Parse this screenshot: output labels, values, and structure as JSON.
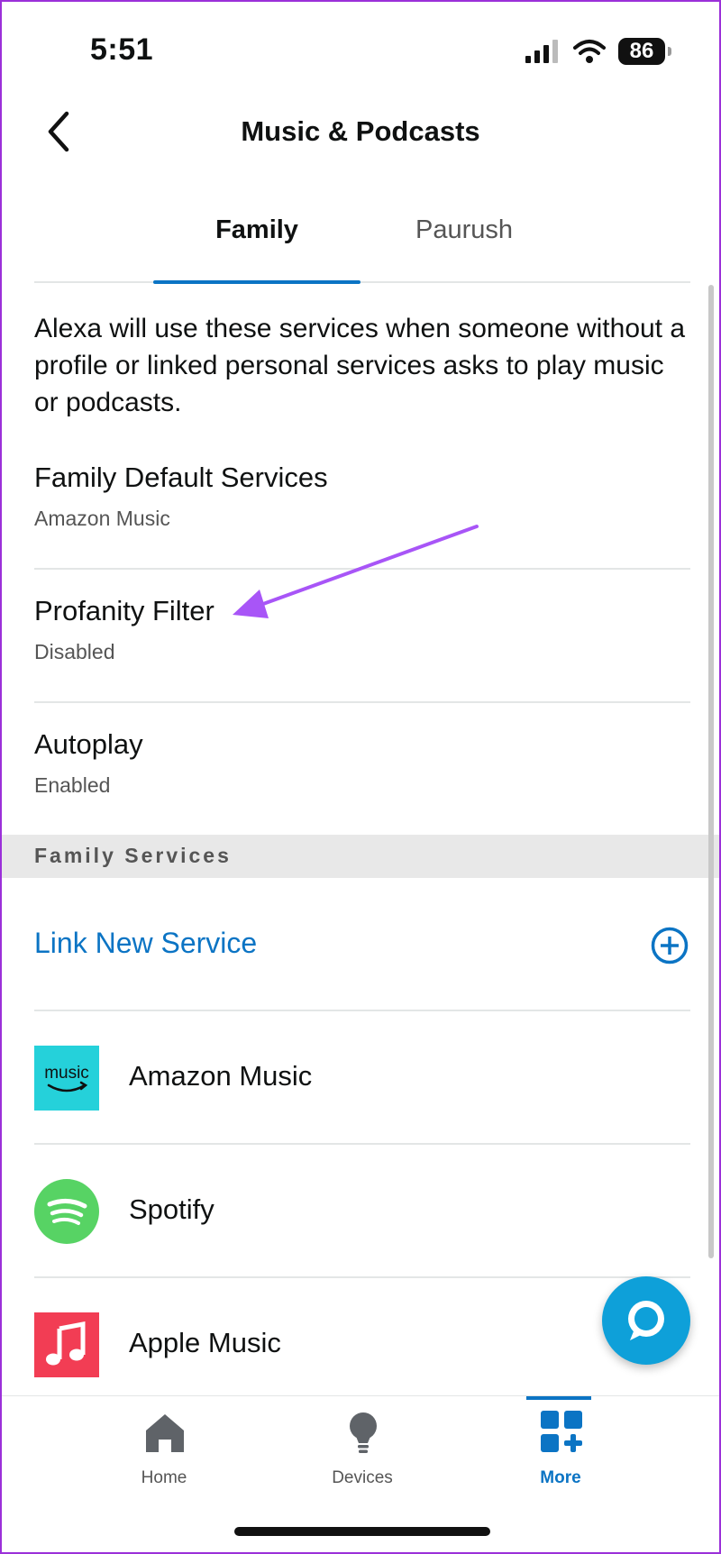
{
  "status_bar": {
    "time": "5:51",
    "battery": "86"
  },
  "header": {
    "title": "Music & Podcasts"
  },
  "tabs": [
    {
      "label": "Family",
      "active": true
    },
    {
      "label": "Paurush",
      "active": false
    }
  ],
  "description": "Alexa will use these services when someone without a profile or linked personal services asks to play music or podcasts.",
  "settings": [
    {
      "title": "Family Default Services",
      "value": "Amazon Music"
    },
    {
      "title": "Profanity Filter",
      "value": "Disabled"
    },
    {
      "title": "Autoplay",
      "value": "Enabled"
    }
  ],
  "family_services": {
    "section_label": "Family Services",
    "link_label": "Link New Service",
    "services": [
      {
        "name": "Amazon Music",
        "logo_text": "music",
        "logo_color": "#25d1da"
      },
      {
        "name": "Spotify",
        "logo_color": "#57d364"
      },
      {
        "name": "Apple Music",
        "logo_color": "#f23d54"
      }
    ]
  },
  "bottom_nav": [
    {
      "label": "Home",
      "icon": "home-icon",
      "active": false
    },
    {
      "label": "Devices",
      "icon": "lightbulb-icon",
      "active": false
    },
    {
      "label": "More",
      "icon": "grid-plus-icon",
      "active": true
    }
  ],
  "colors": {
    "accent": "#0b74c4",
    "annotation_arrow": "#a855f7",
    "alexa_button": "#0ea0d9"
  }
}
